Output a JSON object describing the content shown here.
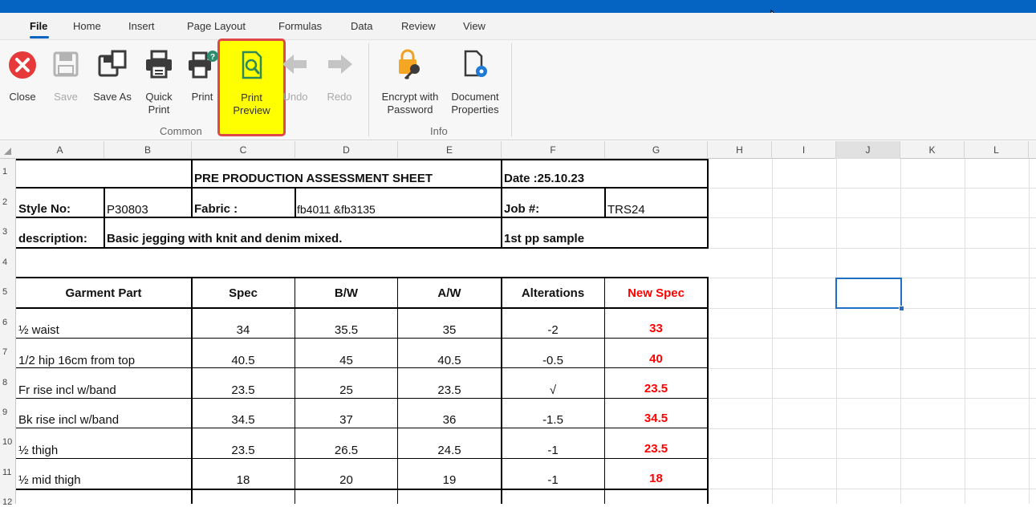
{
  "tabs": [
    "File",
    "Home",
    "Insert",
    "Page Layout",
    "Formulas",
    "Data",
    "Review",
    "View"
  ],
  "ribbon": {
    "close": "Close",
    "save": "Save",
    "save_as": "Save As",
    "quick_print": "Quick\nPrint",
    "print": "Print",
    "print_preview": "Print\nPreview",
    "undo": "Undo",
    "redo": "Redo",
    "encrypt": "Encrypt with\nPassword",
    "doc_props": "Document\nProperties",
    "group_common": "Common",
    "group_info": "Info"
  },
  "columns": [
    "A",
    "B",
    "C",
    "D",
    "E",
    "F",
    "G",
    "H",
    "I",
    "J",
    "K",
    "L"
  ],
  "rows": [
    "1",
    "2",
    "3",
    "4",
    "5",
    "6",
    "7",
    "8",
    "9",
    "10",
    "11",
    "12"
  ],
  "sheet": {
    "title": "PRE PRODUCTION ASSESSMENT SHEET",
    "date": "Date :25.10.23",
    "style_label": "Style No:",
    "style_value": "P30803",
    "fabric_label": "Fabric :",
    "fabric_value": "fb4011 &fb3135",
    "job_label": "Job #:",
    "job_value": "TRS24",
    "desc_label": "description:",
    "desc_value": "Basic jegging with knit and denim mixed.",
    "sample": "1st pp sample",
    "headers": [
      "Garment Part",
      "Spec",
      "B/W",
      "A/W",
      "Alterations",
      "New Spec"
    ],
    "data_rows": [
      {
        "part": "½ waist",
        "spec": "34",
        "bw": "35.5",
        "aw": "35",
        "alt": "-2",
        "new": "33"
      },
      {
        "part": "1/2 hip 16cm from top",
        "spec": "40.5",
        "bw": "45",
        "aw": "40.5",
        "alt": "-0.5",
        "new": "40"
      },
      {
        "part": "Fr rise incl  w/band",
        "spec": "23.5",
        "bw": "25",
        "aw": "23.5",
        "alt": "√",
        "new": "23.5"
      },
      {
        "part": "Bk rise incl  w/band",
        "spec": "34.5",
        "bw": "37",
        "aw": "36",
        "alt": "-1.5",
        "new": "34.5"
      },
      {
        "part": "½ thigh",
        "spec": "23.5",
        "bw": "26.5",
        "aw": "24.5",
        "alt": "-1",
        "new": "23.5"
      },
      {
        "part": "½ mid thigh",
        "spec": "18",
        "bw": "20",
        "aw": "19",
        "alt": "-1",
        "new": "18"
      }
    ]
  },
  "colors": {
    "accent": "#0563c1",
    "highlight": "#ffff00",
    "red": "#ff0000"
  }
}
